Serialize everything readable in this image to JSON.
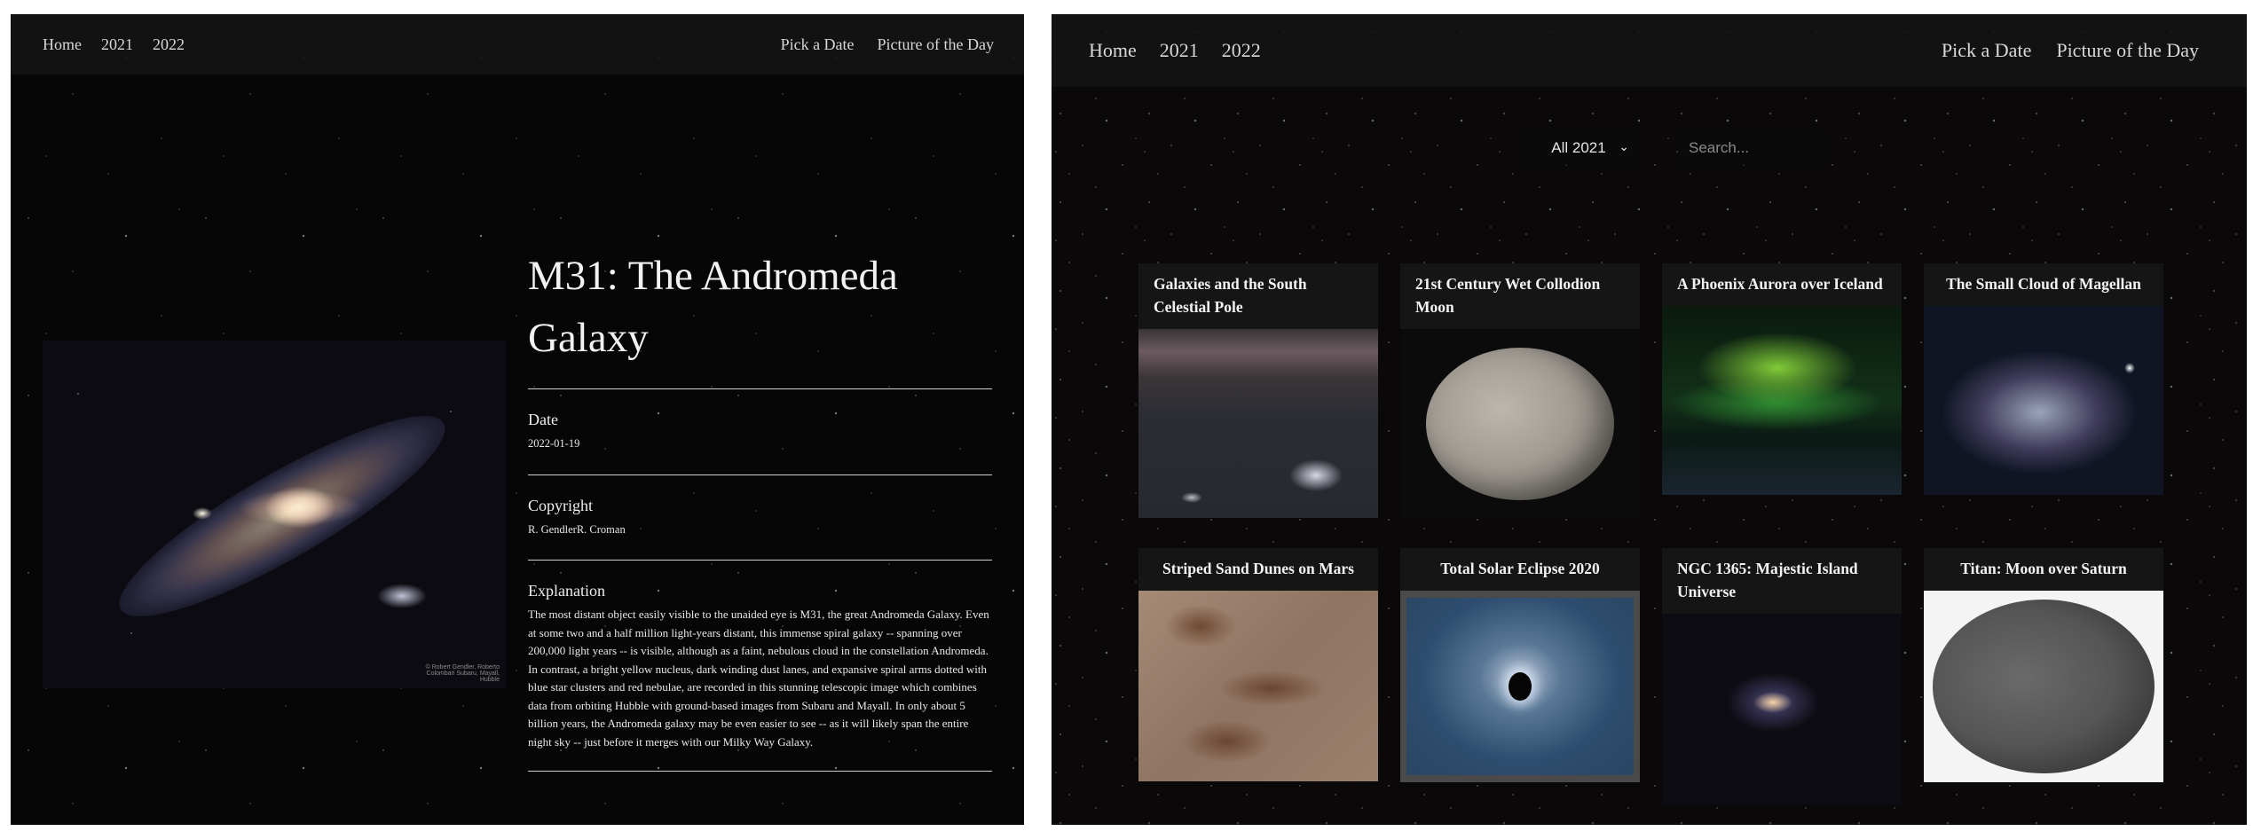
{
  "detail_page": {
    "nav": {
      "left": [
        "Home",
        "2021",
        "2022"
      ],
      "right": [
        "Pick a Date",
        "Picture of the Day"
      ]
    },
    "image_credit": "© Robert Gendler, Roberto Colombari Subaru, Mayall, Hubble",
    "title": "M31: The Andromeda Galaxy",
    "date_label": "Date",
    "date": "2022-01-19",
    "copyright_label": "Copyright",
    "copyright": "R. GendlerR. Croman",
    "explanation_label": "Explanation",
    "explanation": "The most distant object easily visible to the unaided eye is M31, the great Andromeda Galaxy. Even at some two and a half million light-years distant, this immense spiral galaxy -- spanning over 200,000 light years -- is visible, although as a faint, nebulous cloud in the constellation Andromeda. In contrast, a bright yellow nucleus, dark winding dust lanes, and expansive spiral arms dotted with blue star clusters and red nebulae, are recorded in this stunning telescopic image which combines data from orbiting Hubble with ground-based images from Subaru and Mayall. In only about 5 billion years, the Andromeda galaxy may be even easier to see -- as it will likely span the entire night sky -- just before it merges with our Milky Way Galaxy."
  },
  "gallery_page": {
    "nav": {
      "left": [
        "Home",
        "2021",
        "2022"
      ],
      "right": [
        "Pick a Date",
        "Picture of the Day"
      ]
    },
    "filter": {
      "selected": "All 2021",
      "search_placeholder": "Search..."
    },
    "cards": [
      {
        "title": "Galaxies and the South Celestial Pole"
      },
      {
        "title": "21st Century Wet Collodion Moon"
      },
      {
        "title": "A Phoenix Aurora over Iceland"
      },
      {
        "title": "The Small Cloud of Magellan"
      },
      {
        "title": "Striped Sand Dunes on Mars"
      },
      {
        "title": "Total Solar Eclipse 2020"
      },
      {
        "title": "NGC 1365: Majestic Island Universe"
      },
      {
        "title": "Titan: Moon over Saturn"
      }
    ]
  }
}
